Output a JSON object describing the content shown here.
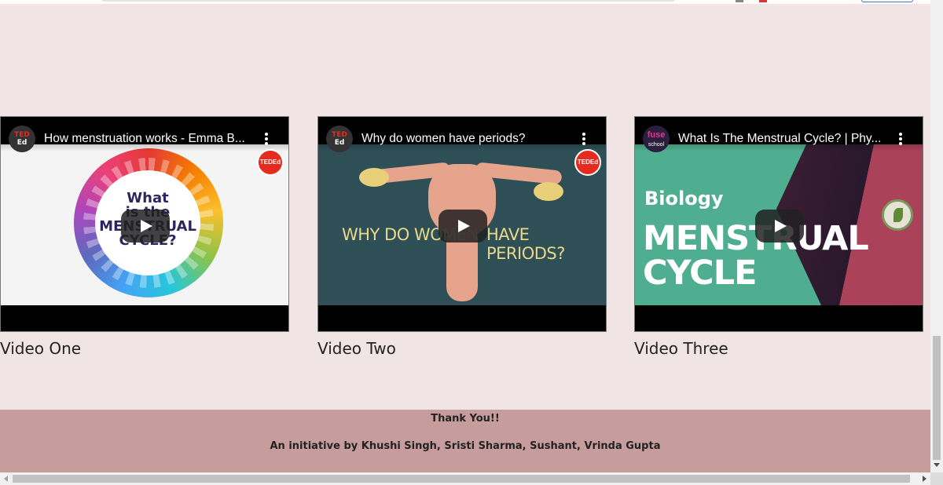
{
  "videos": [
    {
      "youtube_title": "How menstruation works - Emma B...",
      "thumbnail_text": [
        "What",
        "is the",
        "MENSTRUAL",
        "CYCLE?"
      ],
      "caption": "Video One"
    },
    {
      "youtube_title": "Why do women have periods?",
      "thumbnail_text": [
        "WHY DO WOMEN",
        "HAVE PERIODS?"
      ],
      "caption": "Video Two"
    },
    {
      "youtube_title": "What Is The Menstrual Cycle? | Phy...",
      "thumbnail_text": [
        "Biology",
        "MENSTRUAL",
        "CYCLE"
      ],
      "caption": "Video Three"
    }
  ],
  "channel_logos": {
    "ted_top": "TED",
    "ted_bottom": "Ed",
    "fuse_top": "fuse",
    "fuse_bottom": "school",
    "ted_badge": "TEDEd"
  },
  "footer": {
    "thanks": "Thank You!!",
    "credit": "An initiative by Khushi Singh, Sristi Sharma, Sushant, Vrinda Gupta"
  },
  "colors": {
    "page_background": "#f1e4e4",
    "footer_background": "#c69c9c",
    "ted_red": "#e62b1e"
  }
}
